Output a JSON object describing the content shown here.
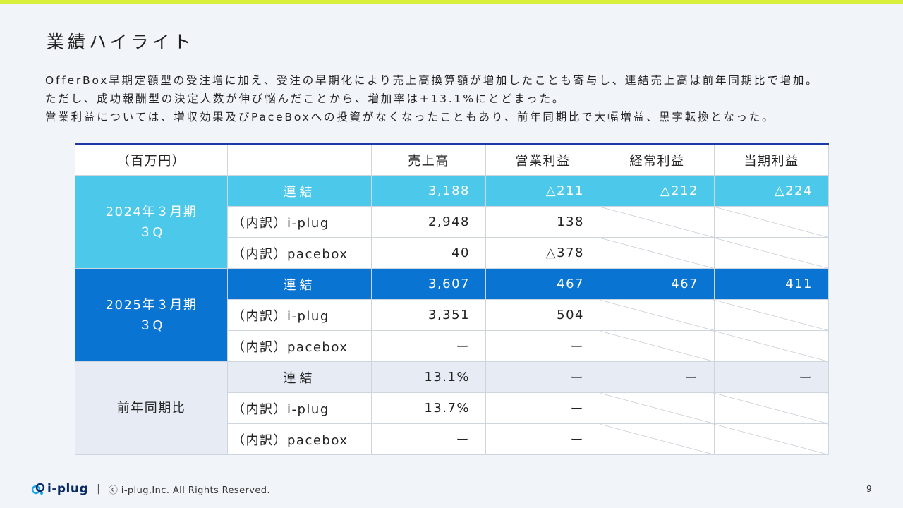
{
  "title": "業績ハイライト",
  "summary": [
    "OfferBox早期定額型の受注増に加え、受注の早期化により売上高換算額が増加したことも寄与し、連結売上高は前年同期比で増加。",
    "ただし、成功報酬型の決定人数が伸び悩んだことから、増加率は+13.1%にとどまった。",
    "営業利益については、増収効果及びPaceBoxへの投資がなくなったこともあり、前年同期比で大幅増益、黒字転換となった。"
  ],
  "table": {
    "headers": {
      "unit": "（百万円）",
      "blank": "",
      "sales": "売上高",
      "operating": "営業利益",
      "ordinary": "経常利益",
      "net": "当期利益"
    },
    "groups": [
      {
        "period_line1": "2024年３月期",
        "period_line2": "３Q",
        "color": "#4cc9ea",
        "rows": [
          {
            "label": "連結",
            "sales": "3,188",
            "operating": "△211",
            "ordinary": "△212",
            "net": "△224"
          },
          {
            "label": "（内訳）i-plug",
            "sales": "2,948",
            "operating": "138"
          },
          {
            "label": "（内訳）pacebox",
            "sales": "40",
            "operating": "△378"
          }
        ]
      },
      {
        "period_line1": "2025年３月期",
        "period_line2": "３Q",
        "color": "#0a74d3",
        "rows": [
          {
            "label": "連結",
            "sales": "3,607",
            "operating": "467",
            "ordinary": "467",
            "net": "411"
          },
          {
            "label": "（内訳）i-plug",
            "sales": "3,351",
            "operating": "504"
          },
          {
            "label": "（内訳）pacebox",
            "sales": "ー",
            "operating": "ー"
          }
        ]
      },
      {
        "period_line1": "前年同期比",
        "color": "#e6ebf4",
        "rows": [
          {
            "label": "連結",
            "sales": "13.1%",
            "operating": "ー",
            "ordinary": "ー",
            "net": "ー"
          },
          {
            "label": "（内訳）i-plug",
            "sales": "13.7%",
            "operating": "ー"
          },
          {
            "label": "（内訳）pacebox",
            "sales": "ー",
            "operating": "ー"
          }
        ]
      }
    ]
  },
  "footer": {
    "logo_text": "i-plug",
    "separator": "|",
    "copyright": "ⓒ i-plug,Inc. All Rights Reserved.",
    "page_number": "9"
  },
  "colors": {
    "accent_bar": "#d9ef3c",
    "table_top_border": "#1b3aa6",
    "fy2024": "#4cc9ea",
    "fy2025": "#0a74d3",
    "yoy": "#e6ebf4"
  }
}
